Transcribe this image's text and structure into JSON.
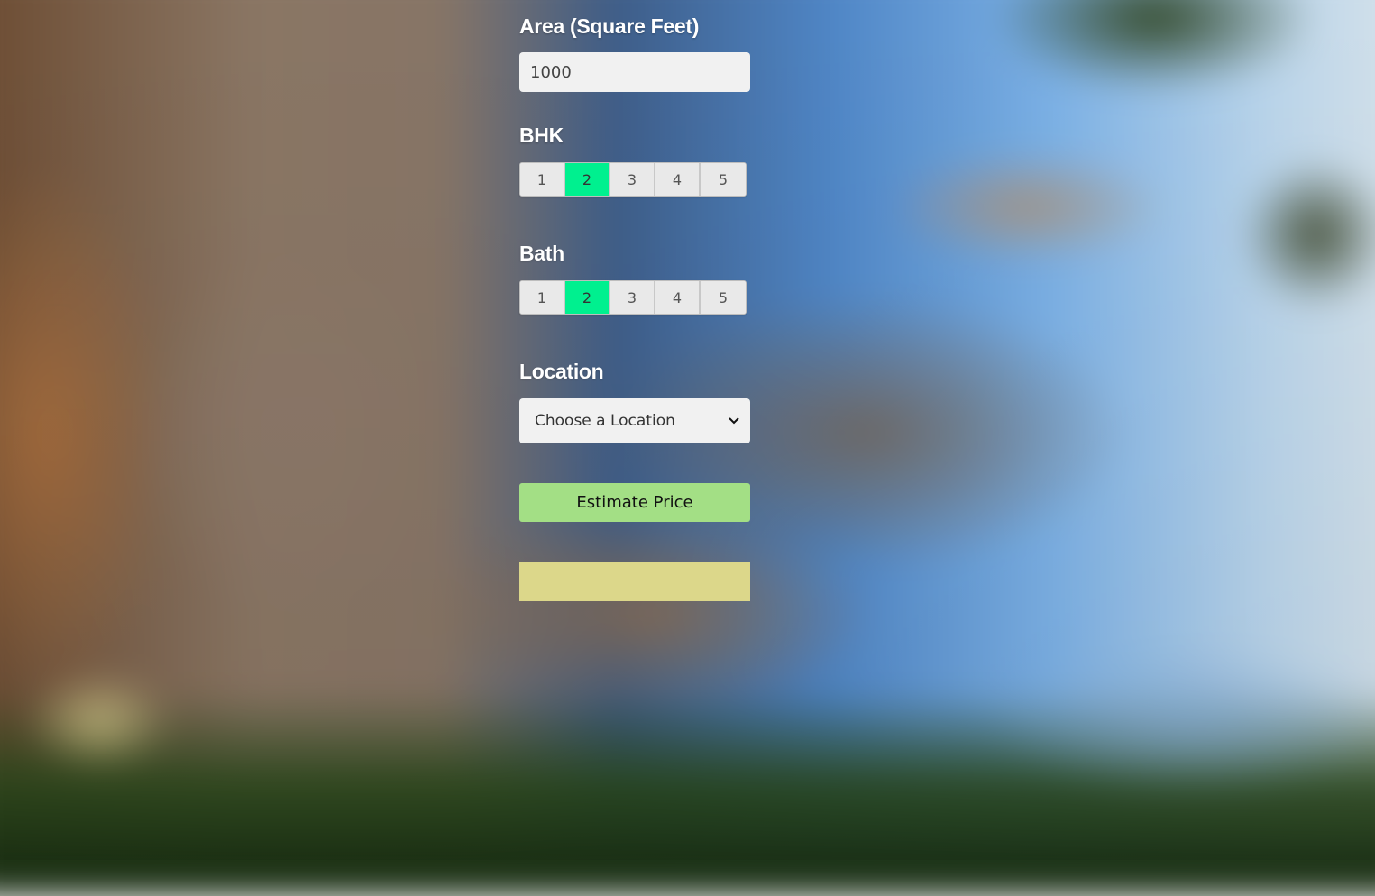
{
  "form": {
    "area": {
      "label": "Area (Square Feet)",
      "value": "1000"
    },
    "bhk": {
      "label": "BHK",
      "options": [
        "1",
        "2",
        "3",
        "4",
        "5"
      ],
      "selected": "2"
    },
    "bath": {
      "label": "Bath",
      "options": [
        "1",
        "2",
        "3",
        "4",
        "5"
      ],
      "selected": "2"
    },
    "location": {
      "label": "Location",
      "selected_text": "Choose a Location",
      "icon": "chevron-down-icon"
    },
    "estimate_button": {
      "label": "Estimate Price"
    },
    "result": {
      "text": ""
    }
  },
  "colors": {
    "selected_option": "#00f08f",
    "estimate_button": "#a3df85",
    "result_box": "#dcd78a",
    "input_bg": "#f1f1f1"
  }
}
